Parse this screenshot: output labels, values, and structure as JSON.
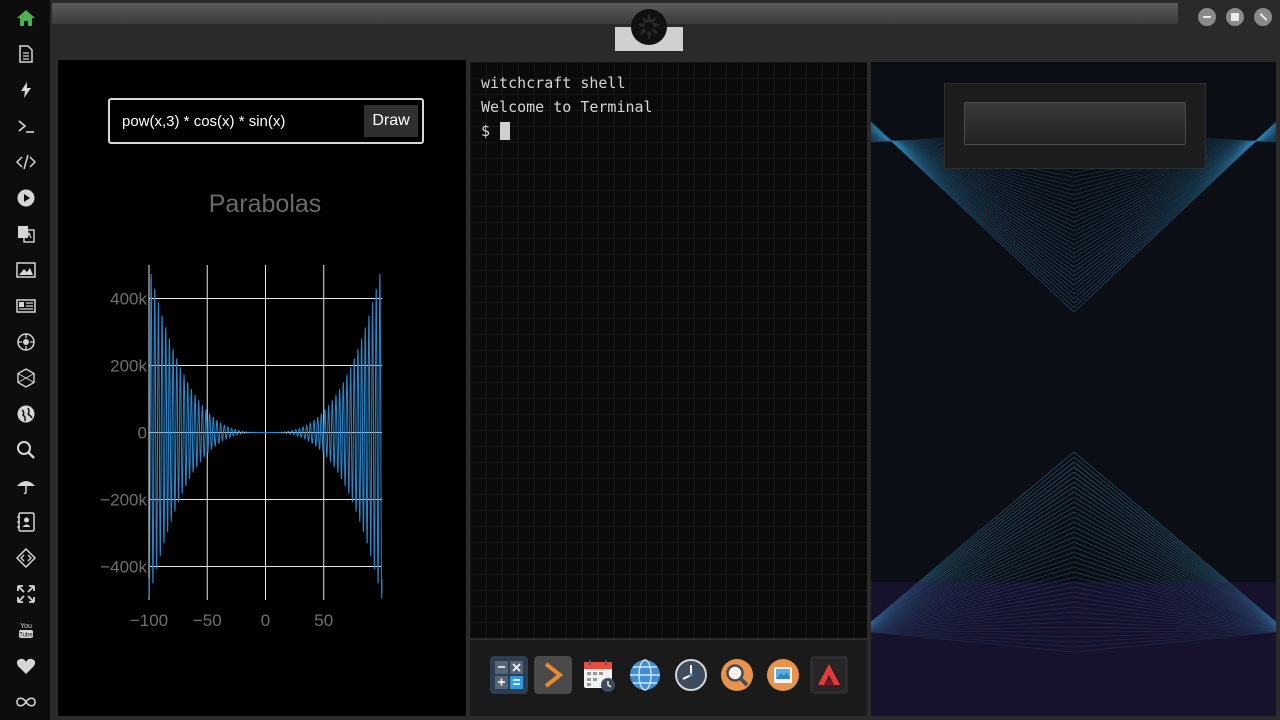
{
  "sidebar": {
    "icons": [
      "home-icon",
      "file-icon",
      "bolt-icon",
      "terminal-icon",
      "code-icon",
      "play-icon",
      "translate-icon",
      "image-icon",
      "newspaper-icon",
      "rebel-icon",
      "hex-icon",
      "globe-icon",
      "search-icon",
      "umbrella-icon",
      "contacts-icon",
      "diamond-code-icon",
      "fullscreen-icon",
      "youtube-icon",
      "heart-icon",
      "infinity-icon"
    ],
    "active_color": "#4caf50"
  },
  "grapher": {
    "function_value": "pow(x,3) * cos(x) * sin(x)",
    "draw_label": "Draw"
  },
  "chart_data": {
    "type": "line",
    "title": "Parabolas",
    "function": "pow(x,3) * cos(x) * sin(x)",
    "xlim": [
      -100,
      100
    ],
    "ylim": [
      -500000,
      500000
    ],
    "xticks": [
      -100,
      -50,
      0,
      50
    ],
    "xtick_labels": [
      "−100",
      "−50",
      "0",
      "50"
    ],
    "yticks": [
      400000,
      200000,
      0,
      -200000,
      -400000
    ],
    "ytick_labels": [
      "400k",
      "200k",
      "0",
      "−200k",
      "−400k"
    ],
    "grid": true,
    "line_color": "#2e86c8"
  },
  "terminal": {
    "lines": [
      "witchcraft shell",
      "Welcome to Terminal"
    ],
    "prompt": "$"
  },
  "dock": {
    "apps": [
      "calculator-icon",
      "terminal-app-icon",
      "calendar-icon",
      "browser-icon",
      "clock-icon",
      "search-app-icon",
      "photos-icon",
      "vector-app-icon"
    ]
  }
}
